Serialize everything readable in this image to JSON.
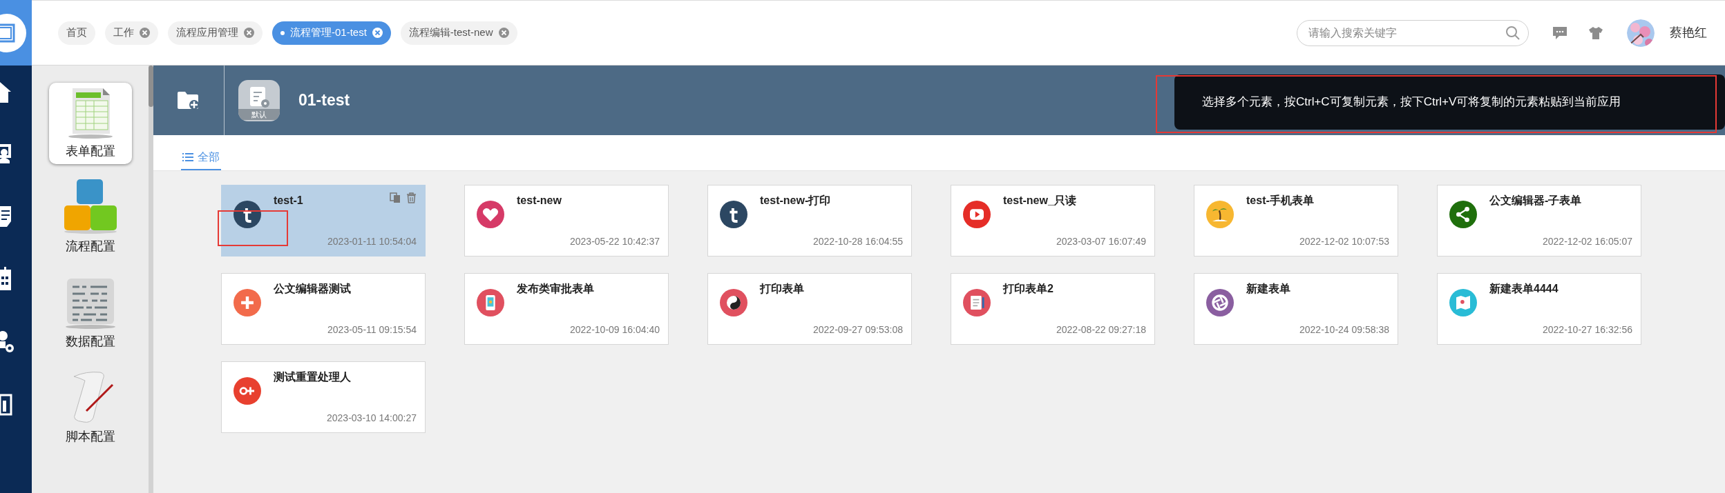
{
  "top_tabs": [
    {
      "label": "首页",
      "selected": false,
      "closable": false
    },
    {
      "label": "工作",
      "selected": false,
      "closable": true
    },
    {
      "label": "流程应用管理",
      "selected": false,
      "closable": true
    },
    {
      "label": "流程管理-01-test",
      "selected": true,
      "closable": true
    },
    {
      "label": "流程编辑-test-new",
      "selected": false,
      "closable": true
    }
  ],
  "search": {
    "placeholder": "请输入搜索关键字"
  },
  "user": {
    "name": "蔡艳红"
  },
  "sidebar": {
    "items": [
      {
        "label": "表单配置",
        "selected": true
      },
      {
        "label": "流程配置",
        "selected": false
      },
      {
        "label": "数据配置",
        "selected": false
      },
      {
        "label": "脚本配置",
        "selected": false
      }
    ]
  },
  "header": {
    "title": "01-test",
    "badge": "默认"
  },
  "view_tabs": [
    {
      "label": "全部",
      "selected": true
    }
  ],
  "tooltip": {
    "text": "选择多个元素，按Ctrl+C可复制元素，按下Ctrl+V可将复制的元素粘贴到当前应用"
  },
  "cards": [
    {
      "title": "test-1",
      "time": "2023-01-11 10:54:04",
      "color": "#2c4762",
      "selected": true
    },
    {
      "title": "test-new",
      "time": "2023-05-22 10:42:37",
      "color": "#d63a67",
      "selected": false
    },
    {
      "title": "test-new-打印",
      "time": "2022-10-28 16:04:55",
      "color": "#2c4762",
      "selected": false
    },
    {
      "title": "test-new_只读",
      "time": "2023-03-07 16:07:49",
      "color": "#e52d27",
      "selected": false
    },
    {
      "title": "test-手机表单",
      "time": "2022-12-02 10:07:53",
      "color": "#f7b731",
      "selected": false
    },
    {
      "title": "公文编辑器-子表单",
      "time": "2022-12-02 16:05:07",
      "color": "#1f6f0c",
      "selected": false
    },
    {
      "title": "公文编辑器测试",
      "time": "2023-05-11 09:15:54",
      "color": "#f26b4b",
      "selected": false
    },
    {
      "title": "发布类审批表单",
      "time": "2022-10-09 16:04:40",
      "color": "#e0505f",
      "selected": false
    },
    {
      "title": "打印表单",
      "time": "2022-09-27 09:53:08",
      "color": "#e0505f",
      "selected": false
    },
    {
      "title": "打印表单2",
      "time": "2022-08-22 09:27:18",
      "color": "#e0505f",
      "selected": false
    },
    {
      "title": "新建表单",
      "time": "2022-10-24 09:58:38",
      "color": "#8a5ea0",
      "selected": false
    },
    {
      "title": "新建表单4444",
      "time": "2022-10-27 16:32:56",
      "color": "#29bcd6",
      "selected": false
    },
    {
      "title": "测试重置处理人",
      "time": "2023-03-10 14:00:27",
      "color": "#e8402f",
      "selected": false
    }
  ]
}
